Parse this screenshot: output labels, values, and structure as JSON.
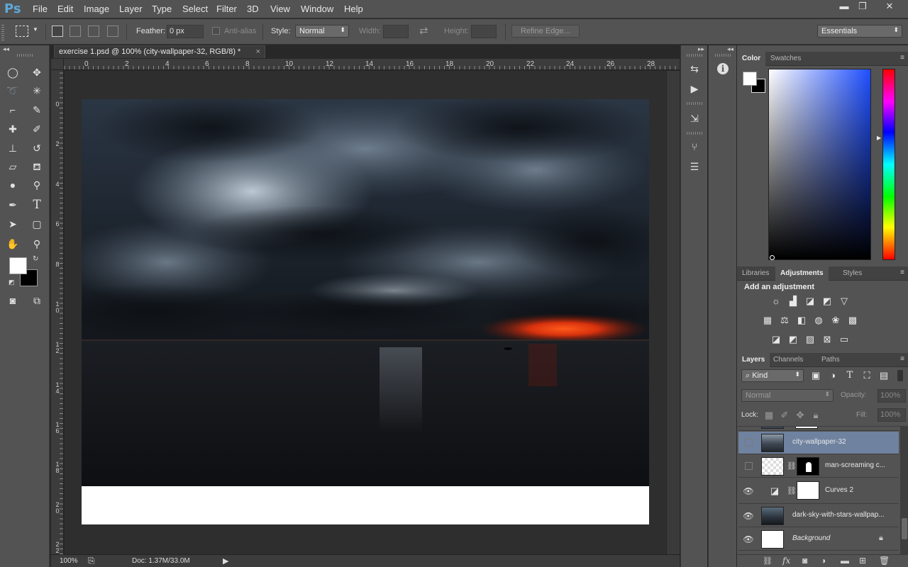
{
  "app": {
    "logo": "Ps"
  },
  "menu": [
    "File",
    "Edit",
    "Image",
    "Layer",
    "Type",
    "Select",
    "Filter",
    "3D",
    "View",
    "Window",
    "Help"
  ],
  "window_controls": {
    "minimize": "▬",
    "restore": "❐",
    "close": "✕"
  },
  "options": {
    "feather_label": "Feather:",
    "feather_value": "0 px",
    "antialias_label": "Anti-alias",
    "style_label": "Style:",
    "style_value": "Normal",
    "width_label": "Width:",
    "height_label": "Height:",
    "refine_edge": "Refine Edge...",
    "workspace": "Essentials"
  },
  "document": {
    "tab_title": "exercise 1.psd @ 100% (city-wallpaper-32, RGB/8) *",
    "tab_close": "×",
    "ruler_h": [
      "0",
      "2",
      "4",
      "6",
      "8",
      "10",
      "12",
      "14",
      "16",
      "18",
      "20",
      "22",
      "24",
      "26",
      "28"
    ],
    "ruler_v": [
      "0",
      "2",
      "4",
      "6",
      "8",
      "10",
      "12",
      "14",
      "16",
      "18",
      "20",
      "22"
    ],
    "zoom": "100%",
    "doc_info": "Doc: 1.37M/33.0M"
  },
  "color_panel": {
    "tabs": [
      "Color",
      "Swatches"
    ]
  },
  "adjustments_panel": {
    "tabs": [
      "Libraries",
      "Adjustments",
      "Styles"
    ],
    "heading": "Add an adjustment"
  },
  "layers_panel": {
    "tabs": [
      "Layers",
      "Channels",
      "Paths"
    ],
    "filter_kind": "Kind",
    "blend_mode": "Normal",
    "opacity_label": "Opacity:",
    "opacity_value": "100%",
    "lock_label": "Lock:",
    "fill_label": "Fill:",
    "fill_value": "100%",
    "layers": [
      {
        "name": "city-wallpaper-32",
        "visible": false,
        "selected": true
      },
      {
        "name": "man-screaming c...",
        "visible": false,
        "selected": false
      },
      {
        "name": "Curves 2",
        "visible": true,
        "selected": false
      },
      {
        "name": "dark-sky-with-stars-wallpap...",
        "visible": true,
        "selected": false
      },
      {
        "name": "Background",
        "visible": true,
        "selected": false
      }
    ]
  },
  "colors": {
    "accent": "#6f82a0",
    "panel": "#535353",
    "canvas": "#282828"
  }
}
